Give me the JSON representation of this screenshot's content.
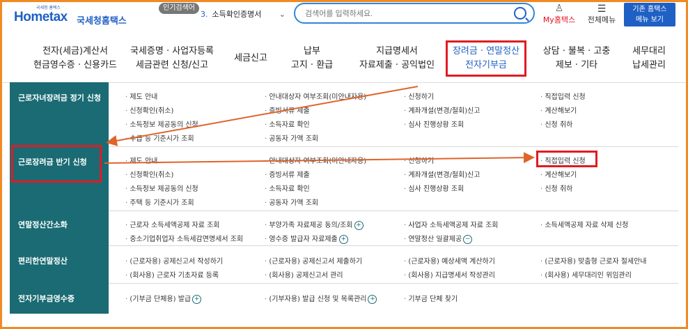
{
  "header": {
    "logo_sub": "국세청 홈택스",
    "logo_main": "Hometax",
    "logo_kr": "국세청홈택스",
    "popular_tag": "인기검색어",
    "search_select_num": "3.",
    "search_select_value": "소득확인증명서",
    "search_placeholder": "검색어를 입력하세요.",
    "myhome_label": "My홈택스",
    "allmenu_label": "전체메뉴",
    "oldmenu_label_1": "기존 홈택스",
    "oldmenu_label_2": "메뉴 보기"
  },
  "nav": [
    {
      "line1": "전자(세금)계산서",
      "line2": "현금영수증 · 신용카드"
    },
    {
      "line1": "국세증명 · 사업자등록",
      "line2": "세금관련 신청/신고"
    },
    {
      "line1": "세금신고",
      "line2": ""
    },
    {
      "line1": "납부",
      "line2": "고지 · 환급"
    },
    {
      "line1": "지급명세서",
      "line2": "자료제출 · 공익법인"
    },
    {
      "line1": "장려금 · 연말정산",
      "line2": "전자기부금"
    },
    {
      "line1": "상담 · 불복 · 고충",
      "line2": "제보 · 기타"
    },
    {
      "line1": "세무대리",
      "line2": "납세관리"
    }
  ],
  "rows": [
    {
      "title": "근로자녀장려금 정기 신청",
      "cols": [
        [
          "제도 안내",
          "신청확인(취소)",
          "소득정보 제공동의 신청",
          "수급 등 기준시가 조회"
        ],
        [
          "안내대상자 여부조회(미안내자용)",
          "증빙서류 제출",
          "소득자료 확인",
          "공동자 가액 조회"
        ],
        [
          "신청하기",
          "계좌개설(변경/철회)신고",
          "심사 진행상황 조회"
        ],
        [
          "직접입력 신청",
          "계산해보기",
          "신청 취하"
        ]
      ]
    },
    {
      "title": "근로장려금 반기 신청",
      "cols": [
        [
          "제도 안내",
          "신청확인(취소)",
          "소득정보 제공동의 신청",
          "주택 등 기준시가 조회"
        ],
        [
          "안내대상자 여부조회(미안내자용)",
          "증빙서류 제출",
          "소득자료 확인",
          "공동자 가액 조회"
        ],
        [
          "신청하기",
          "계좌개설(변경/철회)신고",
          "심사 진행상황 조회"
        ],
        [
          "직접입력 신청",
          "계산해보기",
          "신청 취하"
        ]
      ]
    },
    {
      "title": "연말정산간소화",
      "cols": [
        [
          "근로자 소득세액공제 자료 조회",
          "중소기업취업자 소득세감면명세서 조회"
        ],
        [
          "부양가족 자료제공 동의/조회",
          "영수증 발급자 자료제출"
        ],
        [
          "사업자 소득세액공제 자료 조회",
          "연말정산 일괄제공"
        ],
        [
          "소득세액공제 자료 삭제 신청"
        ]
      ]
    },
    {
      "title": "편리한연말정산",
      "cols": [
        [
          "(근로자용) 공제신고서 작성하기",
          "(회사용) 근로자 기초자료 등록"
        ],
        [
          "(근로자용) 공제신고서 제출하기",
          "(회사용) 공제신고서 관리"
        ],
        [
          "(근로자용) 예상세액 계산하기",
          "(회사용) 지급명세서 작성관리"
        ],
        [
          "(근로자용) 맞춤형 근로자 절세안내",
          "(회사용) 세무대리인 위임관리"
        ]
      ]
    },
    {
      "title": "전자기부금영수증",
      "cols": [
        [
          "(기부금 단체용) 발급"
        ],
        [
          "(기부자용) 발급 신청 및 목록관리"
        ],
        [
          "기부금 단체 찾기"
        ],
        []
      ]
    }
  ]
}
